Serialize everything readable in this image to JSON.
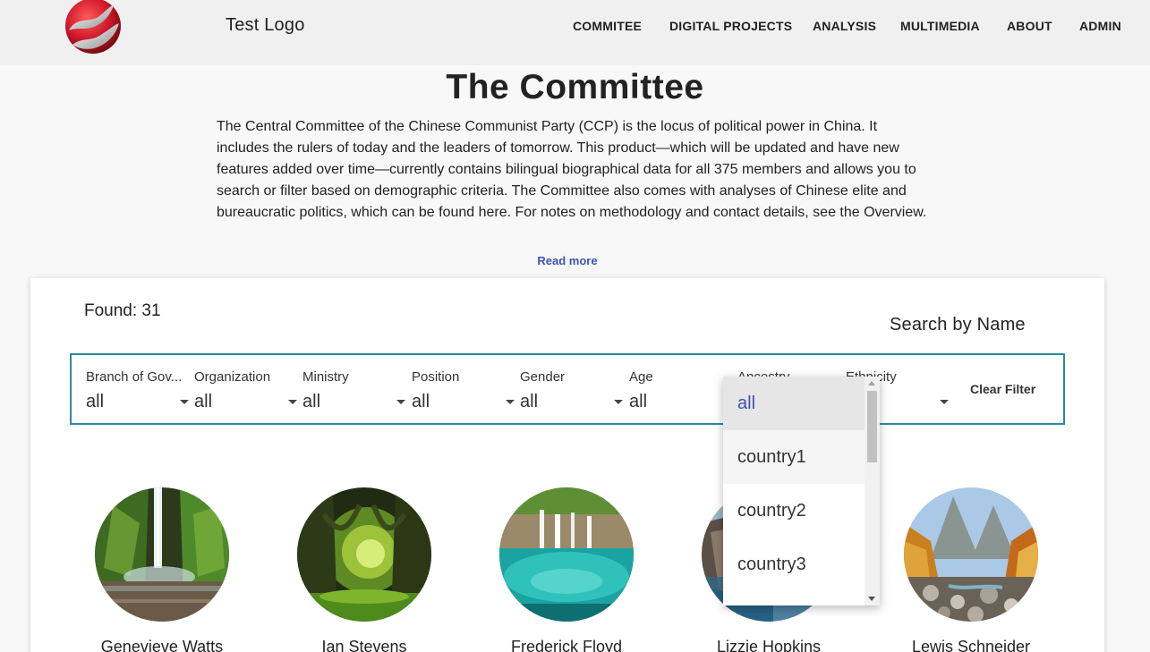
{
  "header": {
    "brand": "Test Logo",
    "nav": [
      "COMMITEE",
      "DIGITAL PROJECTS",
      "ANALYSIS",
      "MULTIMEDIA",
      "ABOUT",
      "ADMIN"
    ]
  },
  "intro": {
    "title": "The Committee",
    "body": "The Central Committee of the Chinese Communist Party (CCP) is the locus of political power in China. It includes the rulers of today and the leaders of tomorrow. This product—which will be updated and have new features added over time—currently contains bilingual biographical data for all 375 members and allows you to search or filter based on demographic criteria. The Committee also comes with analyses of Chinese elite and bureaucratic politics, which can be found here. For notes on methodology and contact details, see the Overview.",
    "read_more": "Read more"
  },
  "results": {
    "found": "Found: 31",
    "search_by_name": "Search by Name"
  },
  "filters": [
    {
      "label": "Branch of Gov...",
      "value": "all"
    },
    {
      "label": "Organization",
      "value": "all"
    },
    {
      "label": "Ministry",
      "value": "all"
    },
    {
      "label": "Position",
      "value": "all"
    },
    {
      "label": "Gender",
      "value": "all"
    },
    {
      "label": "Age",
      "value": "all"
    },
    {
      "label": "Ancestry",
      "value": ""
    },
    {
      "label": "Ethnicity",
      "value": ""
    }
  ],
  "clear_filter": "Clear Filter",
  "ancestry_dropdown": {
    "options": [
      "all",
      "country1",
      "country2",
      "country3"
    ],
    "selected": "all"
  },
  "people": [
    {
      "name": "Genevieve Watts",
      "image": "waterfall-canyon"
    },
    {
      "name": "Ian Stevens",
      "image": "green-forest"
    },
    {
      "name": "Frederick Floyd",
      "image": "turquoise-lake-waterfall"
    },
    {
      "name": "Lizzie Hopkins",
      "image": "rocky-coast"
    },
    {
      "name": "Lewis Schneider",
      "image": "autumn-river-valley"
    }
  ],
  "colors": {
    "accent": "#3f51b5",
    "filter_border": "#2b8a9c",
    "logo_red": "#d0182a"
  }
}
